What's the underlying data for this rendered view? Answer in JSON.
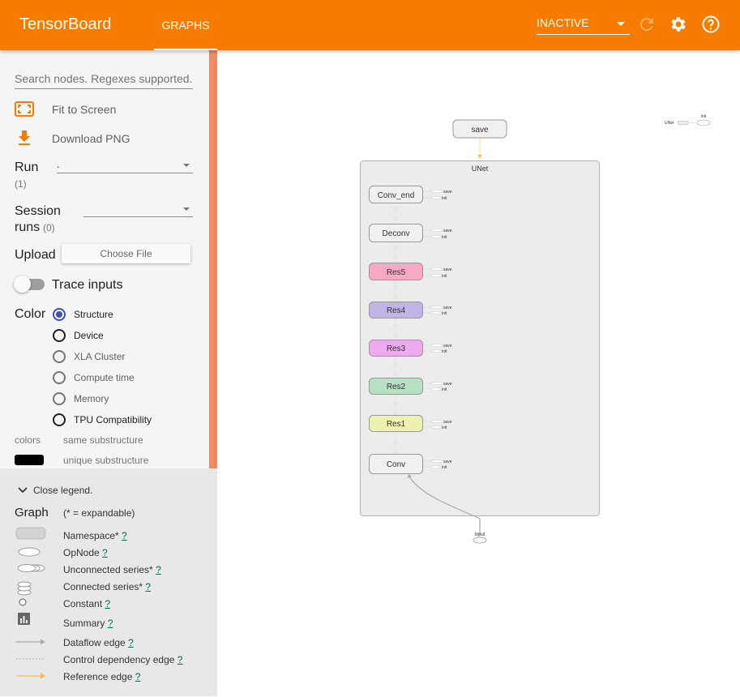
{
  "header": {
    "title": "TensorBoard",
    "tab": "GRAPHS",
    "status": "INACTIVE",
    "colors": {
      "bar": "#f57c00"
    }
  },
  "sidebar": {
    "search_placeholder": "Search nodes. Regexes supported.",
    "fit_label": "Fit to Screen",
    "download_label": "Download PNG",
    "run_label": "Run",
    "run_count": "(1)",
    "run_value": ".",
    "session_label_1": "Session",
    "session_label_2": "runs",
    "session_count": "(0)",
    "upload_label": "Upload",
    "upload_button": "Choose File",
    "trace_label": "Trace inputs",
    "color_label": "Color",
    "color_options": [
      "Structure",
      "Device",
      "XLA Cluster",
      "Compute time",
      "Memory",
      "TPU Compatibility"
    ],
    "colors_label": "colors",
    "same_sub": "same substructure",
    "unique_sub": "unique substructure"
  },
  "legend": {
    "close": "Close legend.",
    "graph": "Graph",
    "expandable": "(* = expandable)",
    "items": [
      "Namespace*",
      "OpNode",
      "Unconnected series*",
      "Connected series*",
      "Constant",
      "Summary",
      "Dataflow edge",
      "Control dependency edge",
      "Reference edge"
    ],
    "help": "?"
  },
  "graph": {
    "save": "save",
    "unet": "UNet",
    "nodes": [
      "Conv_end",
      "Deconv",
      "Res5",
      "Res4",
      "Res3",
      "Res2",
      "Res1",
      "Conv"
    ],
    "node_colors": [
      "#f0f0f0",
      "#f0f0f0",
      "#f7a8c4",
      "#c0b3e6",
      "#eeaaf0",
      "#b7dfc3",
      "#eef2b0",
      "#f0f0f0"
    ],
    "side_save": "save",
    "side_init": "init",
    "input": "input",
    "mini_unet": "UNet",
    "mini_init": "init"
  }
}
